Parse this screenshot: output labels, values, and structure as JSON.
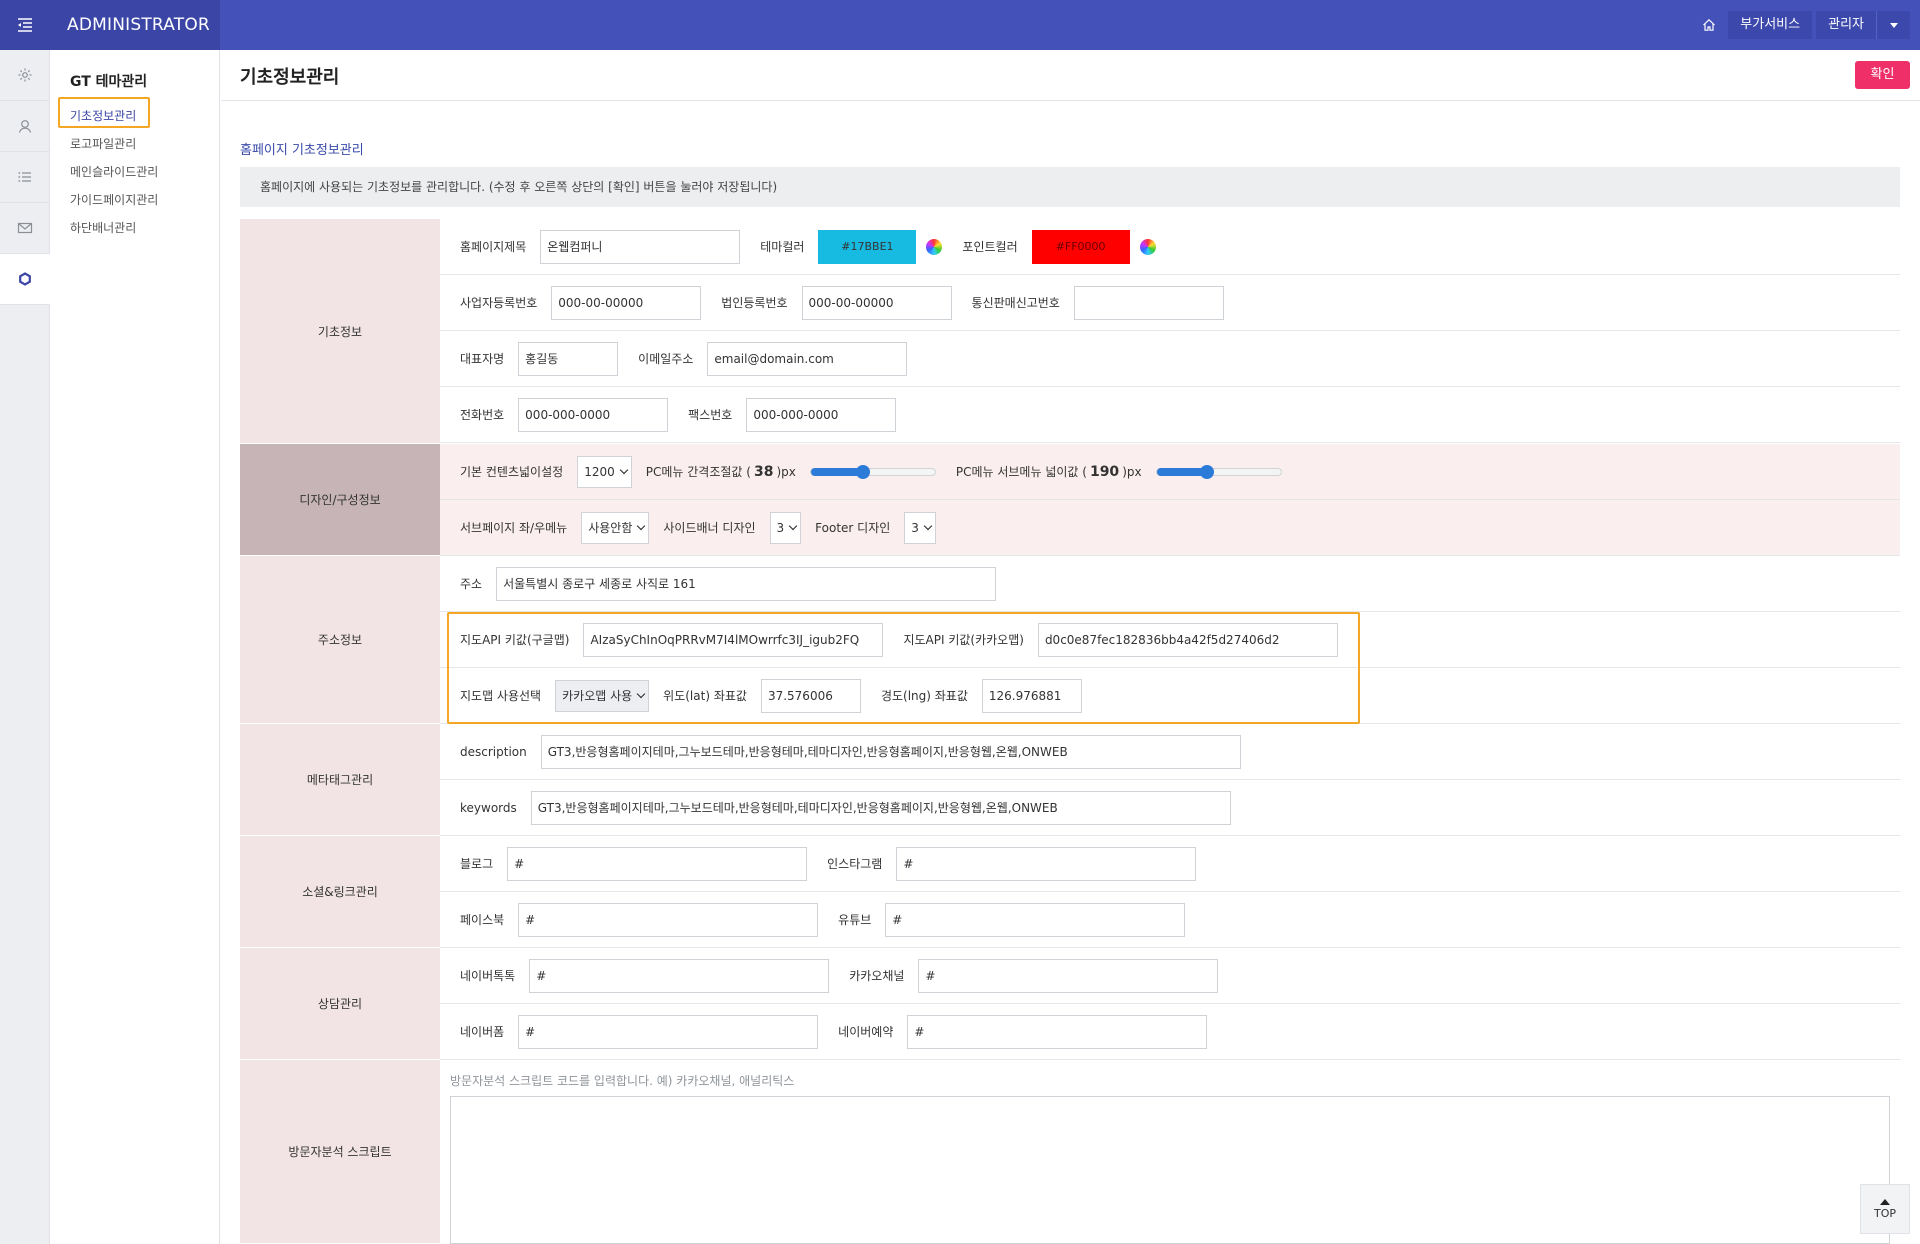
{
  "header": {
    "brand": "ADMINISTRATOR",
    "addon_label": "부가서비스",
    "user_label": "관리자",
    "accent": "#4451b8"
  },
  "rail": {
    "icons": [
      "gear-icon",
      "user-icon",
      "list-icon",
      "mail-icon",
      "theme-icon"
    ]
  },
  "submenu": {
    "title": "GT 테마관리",
    "items": [
      {
        "label": "기초정보관리"
      },
      {
        "label": "로고파일관리"
      },
      {
        "label": "메인슬라이드관리"
      },
      {
        "label": "가이드페이지관리"
      },
      {
        "label": "하단배너관리"
      }
    ]
  },
  "page": {
    "title": "기초정보관리",
    "confirm_label": "확인",
    "section_title": "홈페이지 기초정보관리",
    "notice": "홈페이지에 사용되는 기초정보를 관리합니다. (수정 후 오른쪽 상단의 [확인] 버튼을 눌러야 저장됩니다)"
  },
  "basic": {
    "section": "기초정보",
    "homepage_title_label": "홈페이지제목",
    "homepage_title_value": "온웹컴퍼니",
    "theme_color_label": "테마컬러",
    "theme_color_value": "#17BBE1",
    "point_color_label": "포인트컬러",
    "point_color_value": "#FF0000",
    "biz_no_label": "사업자등록번호",
    "biz_no_value": "000-00-00000",
    "corp_no_label": "법인등록번호",
    "corp_no_value": "000-00-00000",
    "mail_order_label": "통신판매신고번호",
    "mail_order_value": "",
    "ceo_label": "대표자명",
    "ceo_value": "홍길동",
    "email_label": "이메일주소",
    "email_value": "email@domain.com",
    "phone_label": "전화번호",
    "phone_value": "000-000-0000",
    "fax_label": "팩스번호",
    "fax_value": "000-000-0000"
  },
  "design": {
    "section": "디자인/구성정보",
    "content_width_label": "기본 컨텐츠넓이설정",
    "content_width_value": "1200",
    "menu_gap_label": "PC메뉴 간격조절값 (",
    "menu_gap_value": "38",
    "menu_gap_value_pct": 0.42,
    "px_suffix": ")px",
    "submenu_width_label": "PC메뉴 서브메뉴 넓이값 (",
    "submenu_width_value": "190",
    "submenu_width_value_pct": 0.41,
    "subpage_menu_label": "서브페이지 좌/우메뉴",
    "subpage_menu_value": "사용안함",
    "side_banner_label": "사이드배너 디자인",
    "side_banner_value": "3",
    "footer_label": "Footer 디자인",
    "footer_value": "3"
  },
  "address": {
    "section": "주소정보",
    "address_label": "주소",
    "address_value": "서울특별시 종로구 세종로 사직로 161",
    "google_key_label": "지도API 키값(구글맵)",
    "google_key_value": "AIzaSyChInOqPRRvM7I4lMOwrrfc3IJ_igub2FQ",
    "kakao_key_label": "지도API 키값(카카오맵)",
    "kakao_key_value": "d0c0e87fec182836bb4a42f5d27406d2",
    "map_select_label": "지도맵 사용선택",
    "map_select_value": "카카오맵 사용",
    "lat_label": "위도(lat) 좌표값",
    "lat_value": "37.576006",
    "lng_label": "경도(lng) 좌표값",
    "lng_value": "126.976881"
  },
  "meta": {
    "section": "메타태그관리",
    "description_label": "description",
    "description_value": "GT3,반응형홈페이지테마,그누보드테마,반응형테마,테마디자인,반응형홈페이지,반응형웹,온웹,ONWEB",
    "keywords_label": "keywords",
    "keywords_value": "GT3,반응형홈페이지테마,그누보드테마,반응형테마,테마디자인,반응형홈페이지,반응형웹,온웹,ONWEB"
  },
  "social": {
    "section": "소셜&링크관리",
    "blog_label": "블로그",
    "blog_value": "#",
    "instagram_label": "인스타그램",
    "instagram_value": "#",
    "facebook_label": "페이스북",
    "facebook_value": "#",
    "youtube_label": "유튜브",
    "youtube_value": "#"
  },
  "consult": {
    "section": "상담관리",
    "naver_talk_label": "네이버톡톡",
    "naver_talk_value": "#",
    "kakao_channel_label": "카카오채널",
    "kakao_channel_value": "#",
    "naver_form_label": "네이버폼",
    "naver_form_value": "#",
    "naver_booking_label": "네이버예약",
    "naver_booking_value": "#"
  },
  "script": {
    "section": "방문자분석 스크립트",
    "placeholder": "방문자분석 스크립트 코드를 입력합니다. 예) 카카오채널, 애널리틱스"
  },
  "top_label": "TOP"
}
